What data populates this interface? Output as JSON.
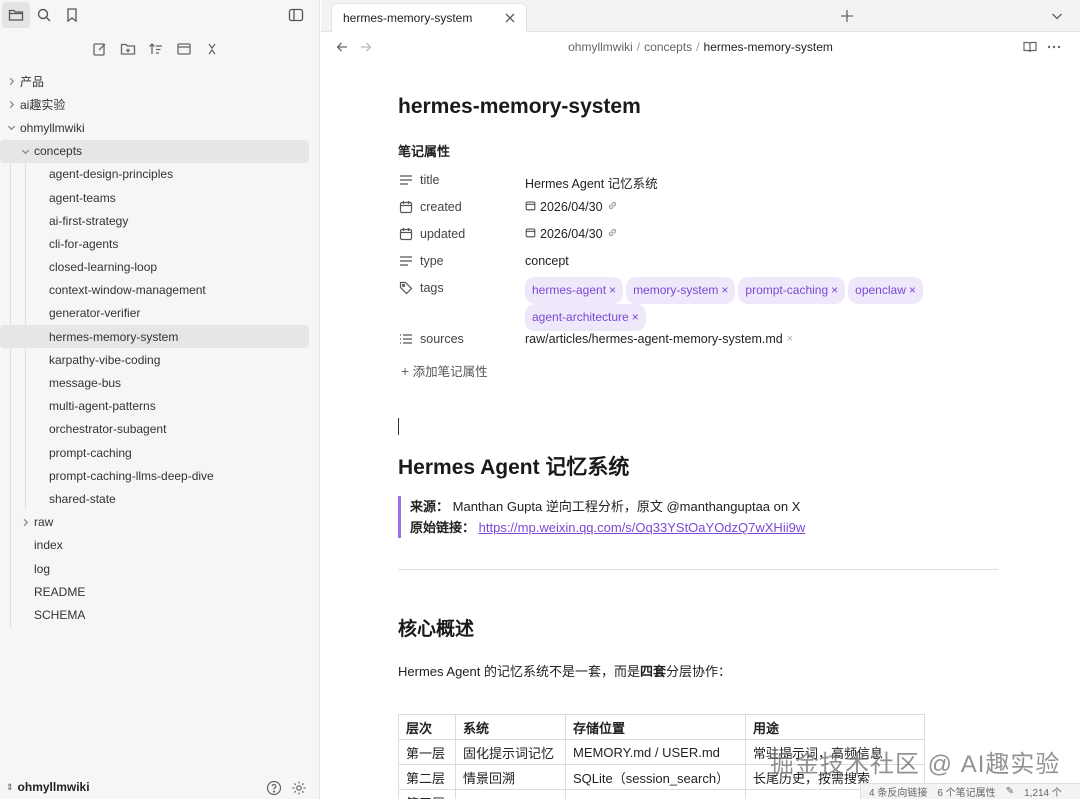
{
  "sidebar": {
    "top_icons": [
      "folder-icon",
      "search-icon",
      "bookmark-icon"
    ],
    "tools": [
      "new-note-icon",
      "new-folder-icon",
      "sort-icon",
      "collapse-all-icon",
      "close-icon"
    ],
    "tree": [
      {
        "label": "产品",
        "depth": 0,
        "chevron": "right"
      },
      {
        "label": "ai趣实验",
        "depth": 0,
        "chevron": "right"
      },
      {
        "label": "ohmyllmwiki",
        "depth": 0,
        "chevron": "down"
      },
      {
        "label": "concepts",
        "depth": 1,
        "chevron": "down"
      },
      {
        "label": "agent-design-principles",
        "depth": 2
      },
      {
        "label": "agent-teams",
        "depth": 2
      },
      {
        "label": "ai-first-strategy",
        "depth": 2
      },
      {
        "label": "cli-for-agents",
        "depth": 2
      },
      {
        "label": "closed-learning-loop",
        "depth": 2
      },
      {
        "label": "context-window-management",
        "depth": 2
      },
      {
        "label": "generator-verifier",
        "depth": 2
      },
      {
        "label": "hermes-memory-system",
        "depth": 2
      },
      {
        "label": "karpathy-vibe-coding",
        "depth": 2
      },
      {
        "label": "message-bus",
        "depth": 2
      },
      {
        "label": "multi-agent-patterns",
        "depth": 2
      },
      {
        "label": "orchestrator-subagent",
        "depth": 2
      },
      {
        "label": "prompt-caching",
        "depth": 2
      },
      {
        "label": "prompt-caching-llms-deep-dive",
        "depth": 2
      },
      {
        "label": "shared-state",
        "depth": 2
      },
      {
        "label": "raw",
        "depth": 1,
        "chevron": "right"
      },
      {
        "label": "index",
        "depth": 1
      },
      {
        "label": "log",
        "depth": 1
      },
      {
        "label": "README",
        "depth": 1
      },
      {
        "label": "SCHEMA",
        "depth": 1
      }
    ],
    "vault_name": "ohmyllmwiki"
  },
  "tabs": [
    {
      "label": "hermes-memory-system"
    }
  ],
  "breadcrumb": [
    "ohmyllmwiki",
    "concepts",
    "hermes-memory-system"
  ],
  "note": {
    "title": "hermes-memory-system",
    "properties_heading": "笔记属性",
    "properties": {
      "title": {
        "key": "title",
        "value": "Hermes Agent 记忆系统"
      },
      "created": {
        "key": "created",
        "value": "2026/04/30"
      },
      "updated": {
        "key": "updated",
        "value": "2026/04/30"
      },
      "type": {
        "key": "type",
        "value": "concept"
      },
      "tags": {
        "key": "tags",
        "values": [
          "hermes-agent",
          "memory-system",
          "prompt-caching",
          "openclaw",
          "agent-architecture"
        ]
      },
      "sources": {
        "key": "sources",
        "value": "raw/articles/hermes-agent-memory-system.md"
      }
    },
    "add_property": "添加笔记属性",
    "h1": "Hermes Agent 记忆系统",
    "quote": {
      "source_label": "来源：",
      "source_text": "Manthan Gupta 逆向工程分析，原文 @manthanguptaa on X",
      "link_label": "原始链接：",
      "link_text": "https://mp.weixin.qq.com/s/Oq33YStOaYOdzQ7wXHii9w"
    },
    "h2": "核心概述",
    "para": {
      "pre": "Hermes Agent 的记忆系统不是一套，而是",
      "bold": "四套",
      "post": "分层协作："
    },
    "table": {
      "headers": [
        "层次",
        "系统",
        "存储位置",
        "用途"
      ],
      "rows": [
        [
          "第一层",
          "固化提示词记忆",
          "MEMORY.md / USER.md",
          "常驻提示词，高频信息"
        ],
        [
          "第二层",
          "情景回溯",
          "SQLite（session_search）",
          "长尾历史，按需搜索"
        ],
        [
          "第三层",
          "",
          "",
          ""
        ]
      ]
    }
  },
  "status": {
    "backlinks": "4 条反向链接",
    "props": "6 个笔记属性",
    "chars": "1,214 个"
  },
  "watermark": "掘金技术社区 @ AI趣实验",
  "colors": {
    "accent": "#7b48d6",
    "tag_bg": "#efe8fb",
    "quote_border": "#9b72e6"
  }
}
